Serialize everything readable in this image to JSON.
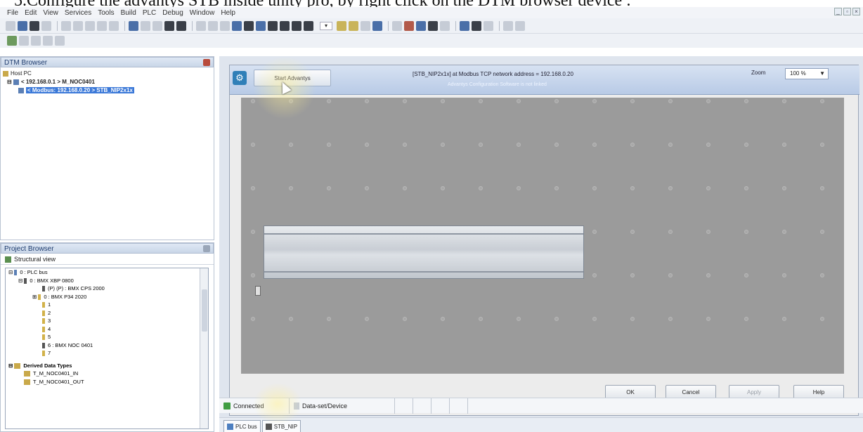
{
  "caption": "5.Configure the advantys STB inside unity pro, by right click on the DTM browser device :",
  "menu": [
    "File",
    "Edit",
    "View",
    "Services",
    "Tools",
    "Build",
    "PLC",
    "Debug",
    "Window",
    "Help"
  ],
  "dtm_browser": {
    "title": "DTM Browser",
    "items": [
      "Host PC",
      "< 192.168.0.1 > M_NOC0401",
      "< Modbus: 192.168.0.20 > STB_NIP2x1x"
    ]
  },
  "project_browser": {
    "title": "Project Browser",
    "view": "Structural view",
    "tree": [
      "0 : PLC bus",
      "0 : BMX XBP 0800",
      "(P) (P) : BMX CPS 2000",
      "0 : BMX P34 2020",
      "1",
      "2",
      "3",
      "4",
      "5",
      "6 : BMX NOC 0401",
      "7"
    ],
    "derived": "Derived Data Types",
    "derived_items": [
      "T_M_NOC0401_IN",
      "T_M_NOC0401_OUT"
    ]
  },
  "dialog": {
    "start_button": "Start Advantys",
    "title": "[STB_NIP2x1x] at Modbus TCP network address = 192.168.0.20",
    "subtitle": "Advantys Configuration Software is not linked",
    "zoom_label": "Zoom",
    "zoom_value": "100 %",
    "buttons": {
      "ok": "OK",
      "cancel": "Cancel",
      "apply": "Apply",
      "help": "Help"
    }
  },
  "status": {
    "connected": "Connected",
    "dataset": "Data-set/Device"
  },
  "tabs": [
    "PLC bus",
    "STB_NIP"
  ]
}
